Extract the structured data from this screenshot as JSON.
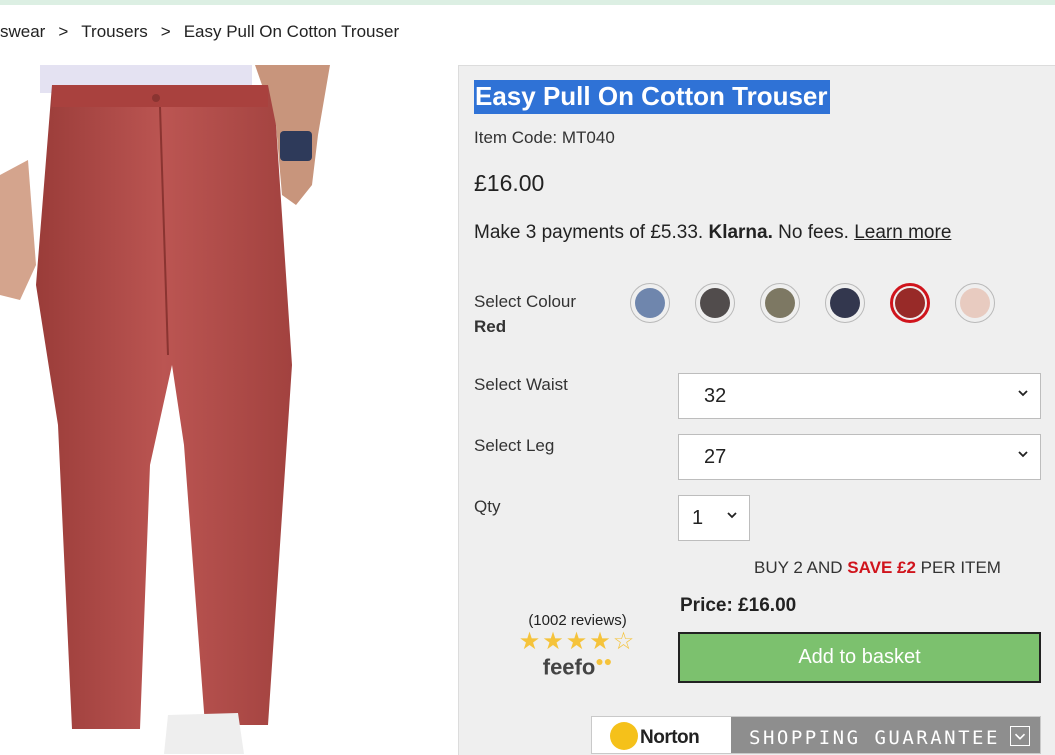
{
  "breadcrumb": {
    "items": [
      "swear",
      "Trousers",
      "Easy Pull On Cotton Trouser"
    ],
    "separator": ">"
  },
  "product": {
    "title": "Easy Pull On Cotton Trouser",
    "item_code": "Item Code: MT040",
    "price": "£16.00",
    "klarna": {
      "prefix": "Make 3 payments of £5.33.",
      "brand": "Klarna.",
      "middle": "No fees.",
      "link": "Learn more"
    }
  },
  "colour": {
    "label": "Select Colour",
    "selected": "Red",
    "swatches": [
      {
        "name": "Blue",
        "color": "#6f86ad"
      },
      {
        "name": "Charcoal",
        "color": "#514c4c"
      },
      {
        "name": "Olive",
        "color": "#7d7863"
      },
      {
        "name": "Navy",
        "color": "#33374e"
      },
      {
        "name": "Red",
        "color": "#982a28",
        "selected": true
      },
      {
        "name": "Pink",
        "color": "#e8cbc0"
      }
    ]
  },
  "waist": {
    "label": "Select Waist",
    "value": "32"
  },
  "leg": {
    "label": "Select Leg",
    "value": "27"
  },
  "qty": {
    "label": "Qty",
    "value": "1"
  },
  "promo": {
    "prefix": "BUY 2 AND",
    "save": "SAVE £2",
    "suffix": "PER ITEM"
  },
  "price_label": "Price: £16.00",
  "basket_label": "Add to basket",
  "feefo": {
    "reviews": "(1002 reviews)",
    "rating": 4,
    "out_of": 5,
    "logo": "feefo"
  },
  "norton": {
    "brand": "Norton",
    "guarantee": "SHOPPING GUARANTEE"
  },
  "colors": {
    "accent": "#7cc16e",
    "highlight": "#2f72d6",
    "sale": "#d0141c",
    "trouser": "#b5504c"
  }
}
